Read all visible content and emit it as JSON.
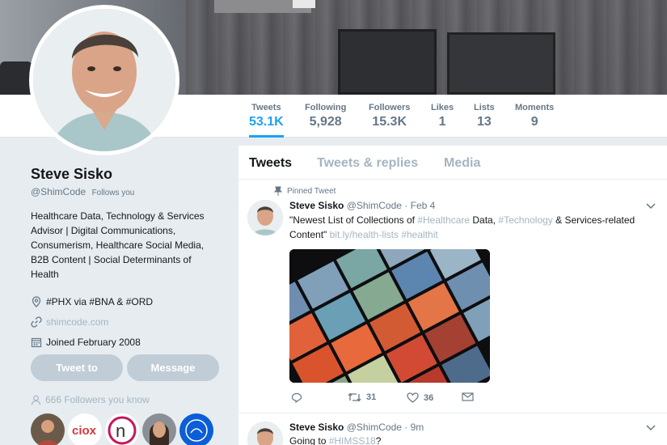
{
  "profile": {
    "name": "Steve Sisko",
    "handle": "@ShimCode",
    "follows_you": "Follows you",
    "bio": "Healthcare Data, Technology & Services Advisor | Digital Communications, Consumerism, Healthcare Social Media, B2B Content | Social Determinants of Health",
    "location": "#PHX via #BNA & #ORD",
    "website": "shimcode.com",
    "joined": "Joined February 2008",
    "tweet_to_label": "Tweet to",
    "message_label": "Message",
    "followers_you_know": "666 Followers you know"
  },
  "stats": [
    {
      "label": "Tweets",
      "value": "53.1K"
    },
    {
      "label": "Following",
      "value": "5,928"
    },
    {
      "label": "Followers",
      "value": "15.3K"
    },
    {
      "label": "Likes",
      "value": "1"
    },
    {
      "label": "Lists",
      "value": "13"
    },
    {
      "label": "Moments",
      "value": "9"
    }
  ],
  "timeline": {
    "tabs": [
      "Tweets",
      "Tweets & replies",
      "Media"
    ],
    "tweets": [
      {
        "pinned_label": "Pinned Tweet",
        "name": "Steve Sisko",
        "handle": "@ShimCode",
        "date": "· Feb 4",
        "text_1": "\"Newest List of Collections of ",
        "tag_1": "#Healthcare",
        "text_2": " Data, ",
        "tag_2": "#Technology",
        "text_3": " & Services-related",
        "text_4": "Content\" ",
        "link": "bit.ly/health-lists",
        "tag_3": " #healthit",
        "retweets": "31",
        "likes": "36"
      },
      {
        "name": "Steve Sisko",
        "handle": "@ShimCode",
        "date": "· 9m",
        "text_1": "Going to ",
        "tag_1": "#HIMSS18",
        "text_2": "?"
      }
    ]
  },
  "colors": {
    "accent": "#1da1f2",
    "muted": "#657786",
    "hashtag": "#a4b5c2",
    "page_bg": "#e6ecf0"
  }
}
